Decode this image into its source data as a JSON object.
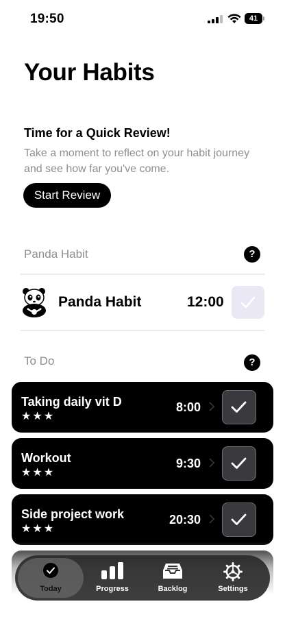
{
  "status_bar": {
    "time": "19:50",
    "battery": "41"
  },
  "page_title": "Your Habits",
  "review": {
    "title": "Time for a Quick Review!",
    "description": "Take a moment to reflect on your habit journey and see how far you've come.",
    "button_label": "Start Review"
  },
  "panda_section": {
    "header": "Panda Habit",
    "help": "?",
    "habit": {
      "name": "Panda Habit",
      "time": "12:00"
    }
  },
  "todo_section": {
    "header": "To Do",
    "help": "?",
    "habits": [
      {
        "name": "Taking daily vit D",
        "stars": "★★★",
        "time": "8:00"
      },
      {
        "name": "Workout",
        "stars": "★★★",
        "time": "9:30"
      },
      {
        "name": "Side project work",
        "stars": "★★★",
        "time": "20:30"
      }
    ]
  },
  "tab_bar": {
    "tabs": [
      {
        "label": "Today",
        "icon": "check-circle-icon",
        "active": true
      },
      {
        "label": "Progress",
        "icon": "bar-chart-icon",
        "active": false
      },
      {
        "label": "Backlog",
        "icon": "tray-icon",
        "active": false
      },
      {
        "label": "Settings",
        "icon": "gear-icon",
        "active": false
      }
    ]
  },
  "colors": {
    "card": "#000000",
    "accent_panda_check": "#ebe8f5",
    "muted_text": "#8e8e93"
  }
}
